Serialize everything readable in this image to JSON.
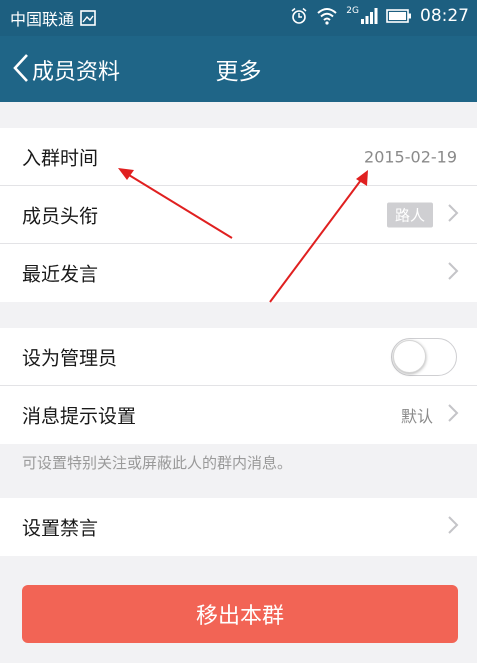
{
  "status_bar": {
    "carrier": "中国联通",
    "time": "08:27",
    "network": "2G"
  },
  "nav": {
    "back_label": "成员资料",
    "title": "更多"
  },
  "group1": [
    {
      "label": "入群时间",
      "value": "2015-02-19"
    },
    {
      "label": "成员头衔",
      "badge": "路人"
    },
    {
      "label": "最近发言"
    }
  ],
  "group2": [
    {
      "label": "设为管理员",
      "toggle_on": false
    },
    {
      "label": "消息提示设置",
      "value": "默认"
    }
  ],
  "hint": "可设置特别关注或屏蔽此人的群内消息。",
  "group3": [
    {
      "label": "设置禁言"
    }
  ],
  "remove_button": "移出本群",
  "colors": {
    "nav_bg": "#1f6587",
    "danger": "#f26455",
    "annotation_arrow": "#e02020"
  }
}
